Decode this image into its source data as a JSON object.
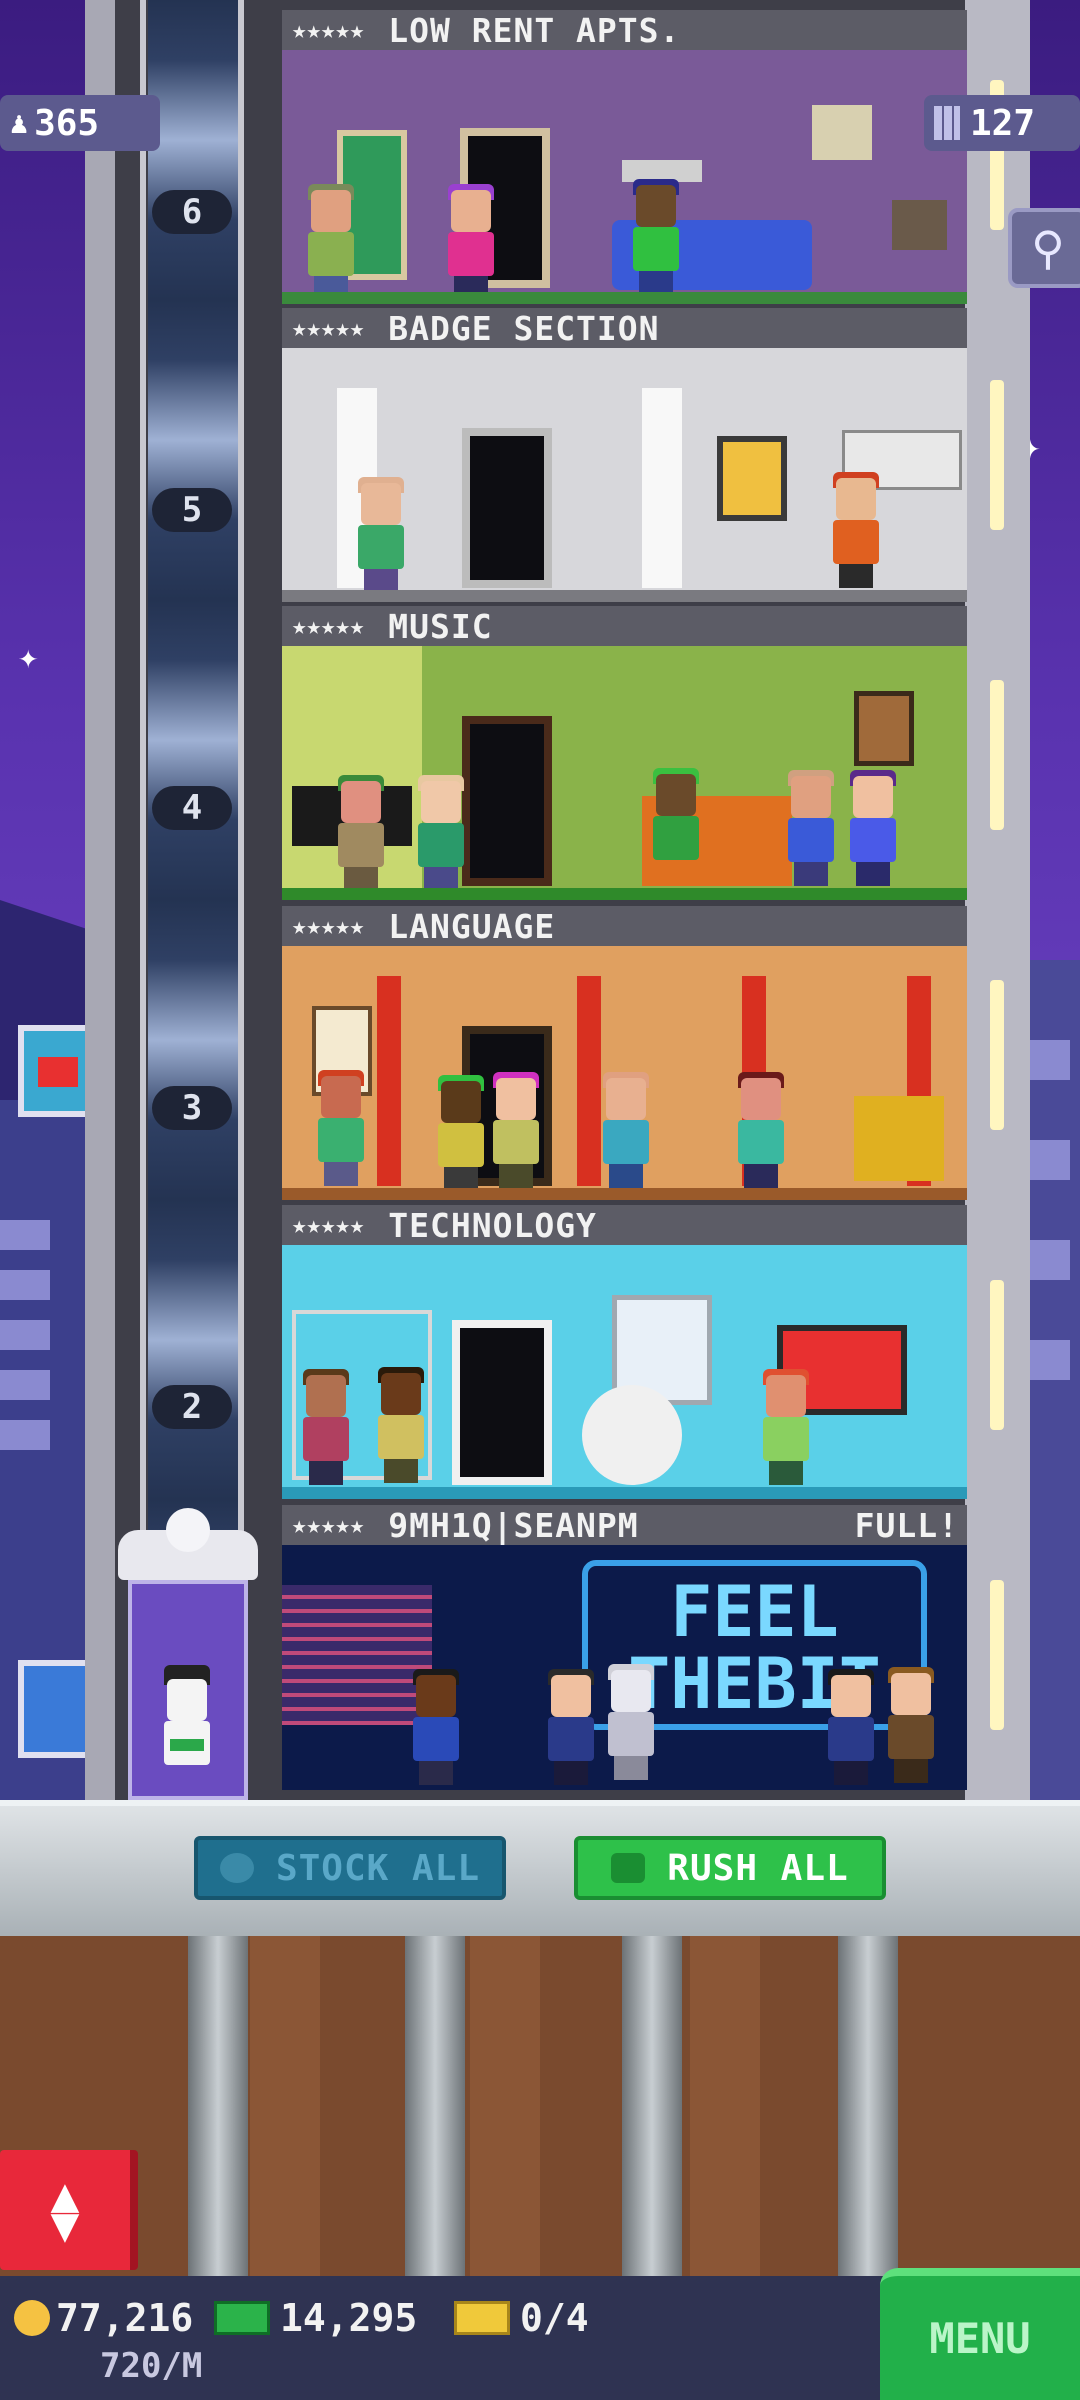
{
  "hud": {
    "population": "365",
    "floors": "127",
    "population_icon": "person-icon",
    "floors_icon": "building-icon",
    "search_icon": "magnifier-icon"
  },
  "floors": [
    {
      "number": "6",
      "stars": "★★★★★",
      "name": "LOW RENT APTS.",
      "status": "",
      "bg": "#7a5a98",
      "ground": "#3a8a3c"
    },
    {
      "number": "5",
      "stars": "★★★★★",
      "name": "BADGE SECTION",
      "status": "",
      "bg": "#d7d7db",
      "ground": "#7a7a80"
    },
    {
      "number": "4",
      "stars": "★★★★★",
      "name": "MUSIC",
      "status": "",
      "bg": "#8ab34a",
      "ground": "#2f8a2a"
    },
    {
      "number": "3",
      "stars": "★★★★★",
      "name": "LANGUAGE",
      "status": "",
      "bg": "#e0a060",
      "ground": "#9a5a2a"
    },
    {
      "number": "2",
      "stars": "★★★★★",
      "name": "TECHNOLOGY",
      "status": "",
      "bg": "#5ad0e8",
      "ground": "#2a9ab8"
    },
    {
      "number": "",
      "stars": "★★★★★",
      "name": "9MH1Q|SEANPM",
      "status": "FULL!",
      "bg": "#0c1a4a",
      "ground": "#16264f"
    }
  ],
  "neon_sign": {
    "line1": "FEEL",
    "line2": "THEBIT"
  },
  "actions": {
    "stock_all": "STOCK ALL",
    "rush_all": "RUSH ALL",
    "stock_icon": "clock-icon",
    "rush_icon": "bux-icon"
  },
  "elevator_button": {
    "up": "▲",
    "down": "▼"
  },
  "resources": {
    "coins": "77,216",
    "coin_rate": "720/M",
    "bux": "14,295",
    "tickets": "0/4"
  },
  "menu_label": "MENU",
  "colors": {
    "sky": "#5a33b0",
    "rush_green": "#2ec14a",
    "stock_blue": "#1f6f8e",
    "menu_green": "#22b04a",
    "elevator_red": "#e8283a"
  }
}
